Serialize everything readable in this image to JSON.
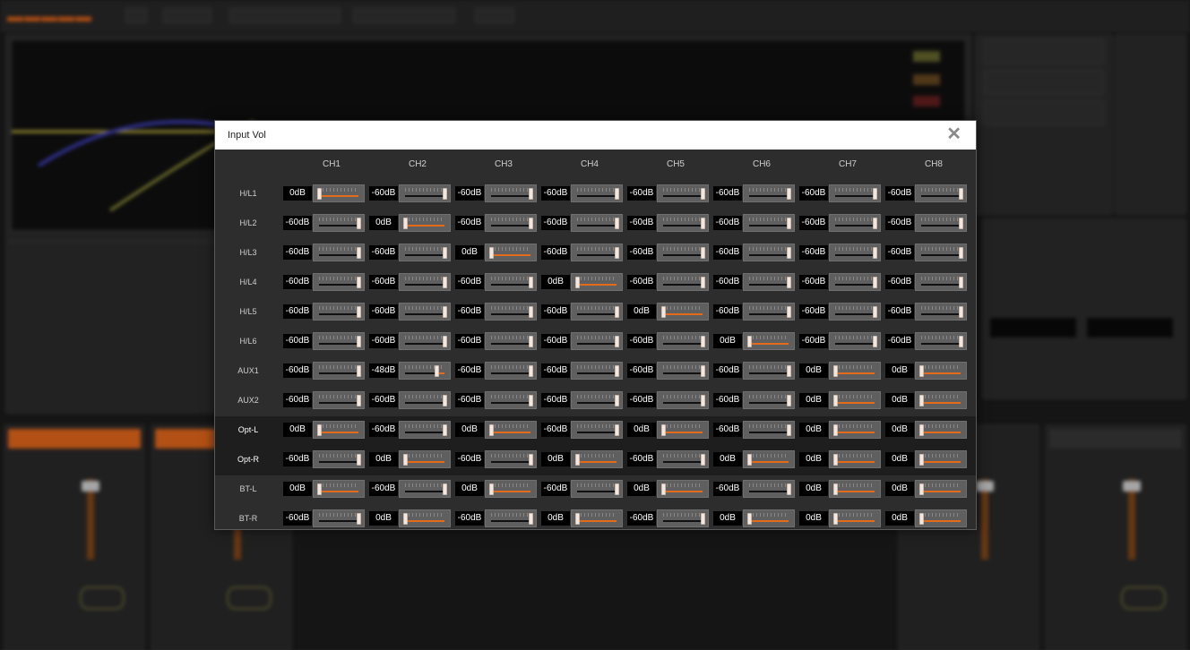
{
  "dialog": {
    "title": "Input Vol",
    "close_icon": "close-icon"
  },
  "channels": [
    "CH1",
    "CH2",
    "CH3",
    "CH4",
    "CH5",
    "CH6",
    "CH7",
    "CH8"
  ],
  "rows": [
    {
      "label": "H/L1",
      "highlight": false,
      "values": [
        "0dB",
        "-60dB",
        "-60dB",
        "-60dB",
        "-60dB",
        "-60dB",
        "-60dB",
        "-60dB"
      ],
      "levels": [
        0,
        1,
        1,
        1,
        1,
        1,
        1,
        1
      ]
    },
    {
      "label": "H/L2",
      "highlight": false,
      "values": [
        "-60dB",
        "0dB",
        "-60dB",
        "-60dB",
        "-60dB",
        "-60dB",
        "-60dB",
        "-60dB"
      ],
      "levels": [
        1,
        0,
        1,
        1,
        1,
        1,
        1,
        1
      ]
    },
    {
      "label": "H/L3",
      "highlight": false,
      "values": [
        "-60dB",
        "-60dB",
        "0dB",
        "-60dB",
        "-60dB",
        "-60dB",
        "-60dB",
        "-60dB"
      ],
      "levels": [
        1,
        1,
        0,
        1,
        1,
        1,
        1,
        1
      ]
    },
    {
      "label": "H/L4",
      "highlight": false,
      "values": [
        "-60dB",
        "-60dB",
        "-60dB",
        "0dB",
        "-60dB",
        "-60dB",
        "-60dB",
        "-60dB"
      ],
      "levels": [
        1,
        1,
        1,
        0,
        1,
        1,
        1,
        1
      ]
    },
    {
      "label": "H/L5",
      "highlight": false,
      "values": [
        "-60dB",
        "-60dB",
        "-60dB",
        "-60dB",
        "0dB",
        "-60dB",
        "-60dB",
        "-60dB"
      ],
      "levels": [
        1,
        1,
        1,
        1,
        0,
        1,
        1,
        1
      ]
    },
    {
      "label": "H/L6",
      "highlight": false,
      "values": [
        "-60dB",
        "-60dB",
        "-60dB",
        "-60dB",
        "-60dB",
        "0dB",
        "-60dB",
        "-60dB"
      ],
      "levels": [
        1,
        1,
        1,
        1,
        1,
        0,
        1,
        1
      ]
    },
    {
      "label": "AUX1",
      "highlight": false,
      "values": [
        "-60dB",
        "-48dB",
        "-60dB",
        "-60dB",
        "-60dB",
        "-60dB",
        "0dB",
        "0dB"
      ],
      "levels": [
        1,
        0.8,
        1,
        1,
        1,
        1,
        0,
        0
      ]
    },
    {
      "label": "AUX2",
      "highlight": false,
      "values": [
        "-60dB",
        "-60dB",
        "-60dB",
        "-60dB",
        "-60dB",
        "-60dB",
        "0dB",
        "0dB"
      ],
      "levels": [
        1,
        1,
        1,
        1,
        1,
        1,
        0,
        0
      ]
    },
    {
      "label": "Opt-L",
      "highlight": true,
      "values": [
        "0dB",
        "-60dB",
        "0dB",
        "-60dB",
        "0dB",
        "-60dB",
        "0dB",
        "0dB"
      ],
      "levels": [
        0,
        1,
        0,
        1,
        0,
        1,
        0,
        0
      ]
    },
    {
      "label": "Opt-R",
      "highlight": true,
      "values": [
        "-60dB",
        "0dB",
        "-60dB",
        "0dB",
        "-60dB",
        "0dB",
        "0dB",
        "0dB"
      ],
      "levels": [
        1,
        0,
        1,
        0,
        1,
        0,
        0,
        0
      ]
    },
    {
      "label": "BT-L",
      "highlight": false,
      "values": [
        "0dB",
        "-60dB",
        "0dB",
        "-60dB",
        "0dB",
        "-60dB",
        "0dB",
        "0dB"
      ],
      "levels": [
        0,
        1,
        0,
        1,
        0,
        1,
        0,
        0
      ]
    },
    {
      "label": "BT-R",
      "highlight": false,
      "values": [
        "-60dB",
        "0dB",
        "-60dB",
        "0dB",
        "-60dB",
        "0dB",
        "0dB",
        "0dB"
      ],
      "levels": [
        1,
        0,
        1,
        0,
        1,
        0,
        0,
        0
      ]
    }
  ],
  "colors": {
    "accent": "#e46a1c",
    "thumb": "#f3e7de",
    "dialog_bg": "#2d2d2d",
    "header_bg": "#ffffff"
  }
}
